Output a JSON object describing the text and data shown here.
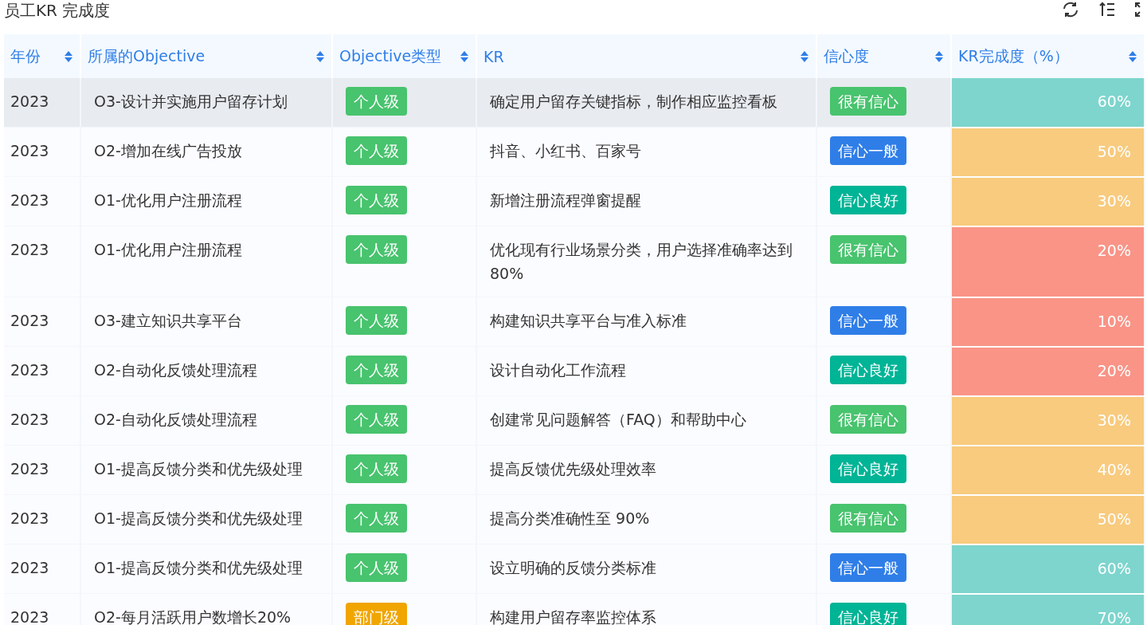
{
  "title": "员工KR 完成度",
  "columns": [
    "年份",
    "所属的Objective",
    "Objective类型",
    "KR",
    "信心度",
    "KR完成度（%）"
  ],
  "rows": [
    {
      "selected": true,
      "year": "2023",
      "objective": "O3-设计并实施用户留存计划",
      "type": {
        "text": "个人级",
        "color": "#48c36e"
      },
      "kr": "确定用户留存关键指标，制作相应监控看板",
      "confidence": {
        "text": "很有信心",
        "color": "#48c36e"
      },
      "completion": {
        "text": "60%",
        "color": "#7dd5cd"
      }
    },
    {
      "selected": false,
      "year": "2023",
      "objective": "O2-增加在线广告投放",
      "type": {
        "text": "个人级",
        "color": "#48c36e"
      },
      "kr": "抖音、小红书、百家号",
      "confidence": {
        "text": "信心一般",
        "color": "#2f7ee8"
      },
      "completion": {
        "text": "50%",
        "color": "#f8cb7f"
      }
    },
    {
      "selected": false,
      "year": "2023",
      "objective": "O1-优化用户注册流程",
      "type": {
        "text": "个人级",
        "color": "#48c36e"
      },
      "kr": "新增注册流程弹窗提醒",
      "confidence": {
        "text": "信心良好",
        "color": "#00b496"
      },
      "completion": {
        "text": "30%",
        "color": "#f8cb7f"
      }
    },
    {
      "selected": false,
      "year": "2023",
      "objective": "O1-优化用户注册流程",
      "type": {
        "text": "个人级",
        "color": "#48c36e"
      },
      "kr": "优化现有行业场景分类，用户选择准确率达到80%",
      "confidence": {
        "text": "很有信心",
        "color": "#48c36e"
      },
      "completion": {
        "text": "20%",
        "color": "#f99487"
      }
    },
    {
      "selected": false,
      "year": "2023",
      "objective": "O3-建立知识共享平台",
      "type": {
        "text": "个人级",
        "color": "#48c36e"
      },
      "kr": "构建知识共享平台与准入标准",
      "confidence": {
        "text": "信心一般",
        "color": "#2f7ee8"
      },
      "completion": {
        "text": "10%",
        "color": "#f99487"
      }
    },
    {
      "selected": false,
      "year": "2023",
      "objective": "O2-自动化反馈处理流程",
      "type": {
        "text": "个人级",
        "color": "#48c36e"
      },
      "kr": "设计自动化工作流程",
      "confidence": {
        "text": "信心良好",
        "color": "#00b496"
      },
      "completion": {
        "text": "20%",
        "color": "#f99487"
      }
    },
    {
      "selected": false,
      "year": "2023",
      "objective": "O2-自动化反馈处理流程",
      "type": {
        "text": "个人级",
        "color": "#48c36e"
      },
      "kr": "创建常见问题解答（FAQ）和帮助中心",
      "confidence": {
        "text": "很有信心",
        "color": "#48c36e"
      },
      "completion": {
        "text": "30%",
        "color": "#f8cb7f"
      }
    },
    {
      "selected": false,
      "year": "2023",
      "objective": "O1-提高反馈分类和优先级处理",
      "type": {
        "text": "个人级",
        "color": "#48c36e"
      },
      "kr": "提高反馈优先级处理效率",
      "confidence": {
        "text": "信心良好",
        "color": "#00b496"
      },
      "completion": {
        "text": "40%",
        "color": "#f8cb7f"
      }
    },
    {
      "selected": false,
      "year": "2023",
      "objective": "O1-提高反馈分类和优先级处理",
      "type": {
        "text": "个人级",
        "color": "#48c36e"
      },
      "kr": "提高分类准确性至 90%",
      "confidence": {
        "text": "很有信心",
        "color": "#48c36e"
      },
      "completion": {
        "text": "50%",
        "color": "#f8cb7f"
      }
    },
    {
      "selected": false,
      "year": "2023",
      "objective": "O1-提高反馈分类和优先级处理",
      "type": {
        "text": "个人级",
        "color": "#48c36e"
      },
      "kr": "设立明确的反馈分类标准",
      "confidence": {
        "text": "信心一般",
        "color": "#2f7ee8"
      },
      "completion": {
        "text": "60%",
        "color": "#7dd5cd"
      }
    },
    {
      "selected": false,
      "year": "2023",
      "objective": "O2-每月活跃用户数增长20%",
      "type": {
        "text": "部门级",
        "color": "#f0a500"
      },
      "kr": "构建用户留存率监控体系",
      "confidence": {
        "text": "信心良好",
        "color": "#00b496"
      },
      "completion": {
        "text": "70%",
        "color": "#7dd5cd"
      }
    }
  ]
}
